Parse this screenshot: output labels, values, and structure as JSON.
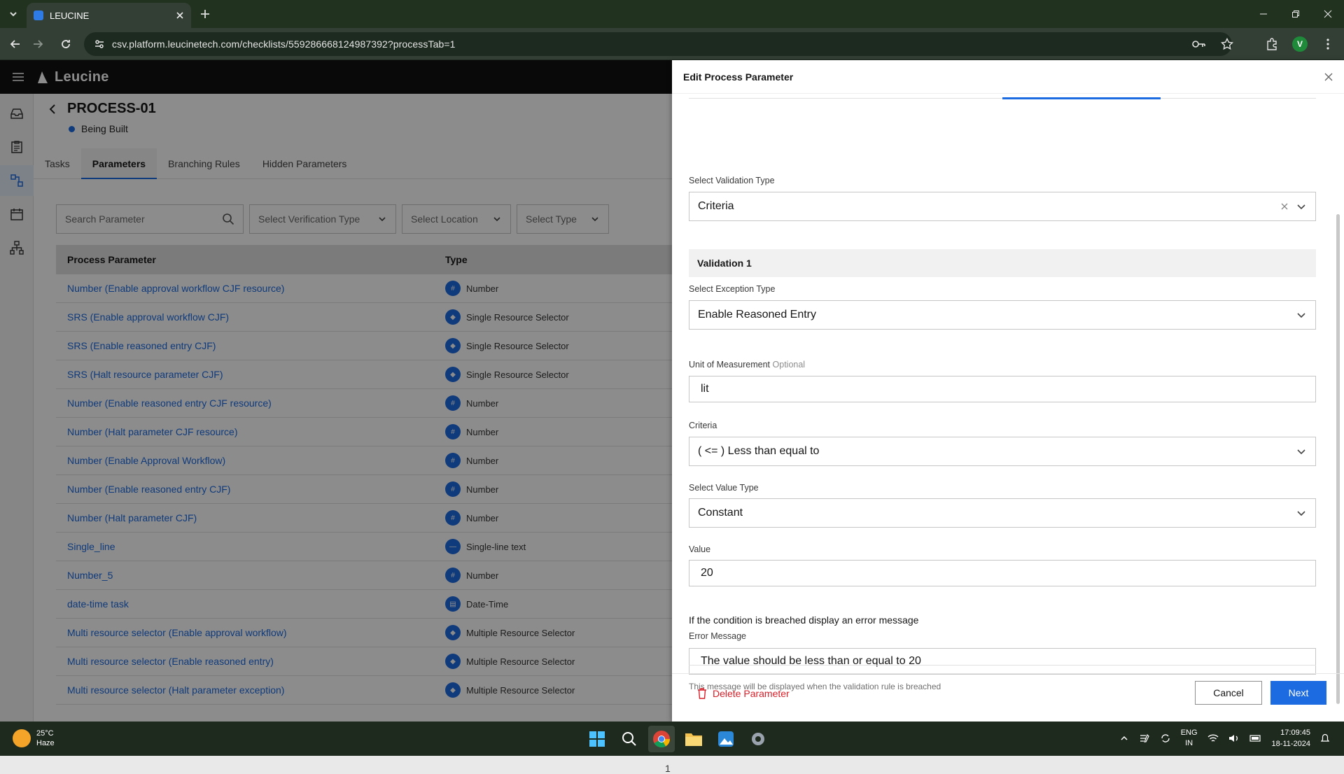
{
  "browser": {
    "tab_title": "LEUCINE",
    "url": "csv.platform.leucinetech.com/checklists/559286668124987392?processTab=1",
    "profile_initial": "V"
  },
  "app": {
    "brand": "Leucine",
    "process_title": "PROCESS-01",
    "status": "Being Built",
    "tabs": [
      "Tasks",
      "Parameters",
      "Branching Rules",
      "Hidden Parameters"
    ],
    "filters": {
      "search_placeholder": "Search Parameter",
      "verification": "Select Verification Type",
      "location": "Select Location",
      "type": "Select Type"
    },
    "table": {
      "headers": [
        "Process Parameter",
        "Type"
      ],
      "rows": [
        {
          "name": "Number (Enable approval workflow CJF resource)",
          "type": "Number"
        },
        {
          "name": "SRS (Enable approval workflow CJF)",
          "type": "Single Resource Selector"
        },
        {
          "name": "SRS (Enable reasoned entry CJF)",
          "type": "Single Resource Selector"
        },
        {
          "name": "SRS (Halt resource parameter CJF)",
          "type": "Single Resource Selector"
        },
        {
          "name": "Number (Enable reasoned entry CJF resource)",
          "type": "Number"
        },
        {
          "name": "Number (Halt parameter CJF resource)",
          "type": "Number"
        },
        {
          "name": "Number (Enable Approval Workflow)",
          "type": "Number"
        },
        {
          "name": "Number (Enable reasoned entry CJF)",
          "type": "Number"
        },
        {
          "name": "Number (Halt parameter CJF)",
          "type": "Number"
        },
        {
          "name": "Single_line",
          "type": "Single-line text"
        },
        {
          "name": "Number_5",
          "type": "Number"
        },
        {
          "name": "date-time task",
          "type": "Date-Time"
        },
        {
          "name": "Multi resource selector (Enable approval workflow)",
          "type": "Multiple Resource Selector"
        },
        {
          "name": "Multi resource selector (Enable reasoned entry)",
          "type": "Multiple Resource Selector"
        },
        {
          "name": "Multi resource selector (Halt parameter exception)",
          "type": "Multiple Resource Selector"
        }
      ]
    },
    "pager_fragment": "1"
  },
  "drawer": {
    "title": "Edit Process Parameter",
    "validation_type_label": "Select Validation Type",
    "validation_type_value": "Criteria",
    "validation_header": "Validation 1",
    "exception_label": "Select Exception Type",
    "exception_value": "Enable Reasoned Entry",
    "uom_label": "Unit of Measurement",
    "uom_optional": "Optional",
    "uom_value": "lit",
    "criteria_label": "Criteria",
    "criteria_value": "( <= ) Less than equal to",
    "value_type_label": "Select Value Type",
    "value_type_value": "Constant",
    "value_label": "Value",
    "value_value": "20",
    "breach_text": "If the condition is breached display an error message",
    "error_label": "Error Message",
    "error_value": "The value should be less than or equal to 20",
    "helper_text": "This message will be displayed when the validation rule is breached",
    "delete_label": "Delete Parameter",
    "cancel_label": "Cancel",
    "next_label": "Next"
  },
  "taskbar": {
    "temp": "25°C",
    "weather": "Haze",
    "lang1": "ENG",
    "lang2": "IN",
    "time": "17:09:45",
    "date": "18-11-2024"
  },
  "colors": {
    "accent": "#1d6be0",
    "danger": "#da1e28"
  }
}
